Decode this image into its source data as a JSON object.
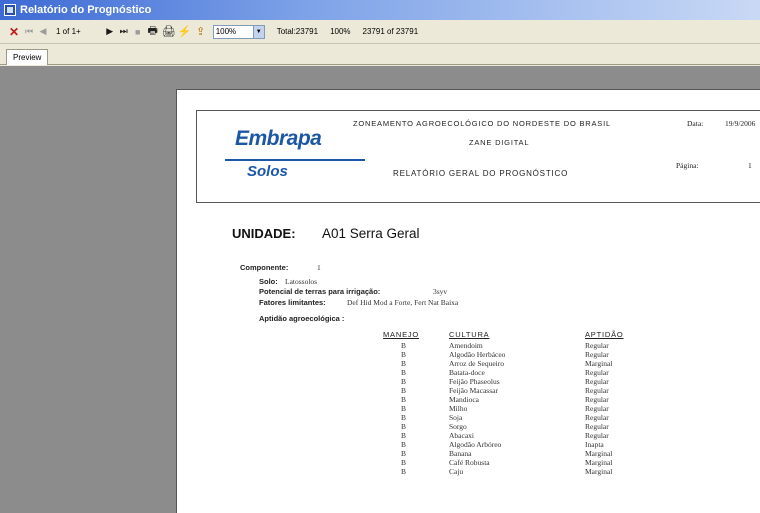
{
  "window": {
    "title": "Relatório do Prognóstico"
  },
  "toolbar": {
    "page_count": "1 of 1+",
    "zoom": "100%",
    "total": "Total:23791",
    "percent": "100%",
    "records": "23791 of 23791"
  },
  "tabs": [
    {
      "label": "Preview"
    }
  ],
  "report": {
    "logo_top": "Embrapa",
    "logo_bottom": "Solos",
    "header_line1": "ZONEAMENTO AGROECOLÓGICO DO NORDESTE DO BRASIL",
    "header_line2": "ZANE DIGITAL",
    "header_line3": "RELATÓRIO GERAL DO PROGNÓSTICO",
    "date_label": "Data:",
    "date_value": "19/9/2006",
    "page_label": "Página:",
    "page_value": "1",
    "unidade_label": "UNIDADE:",
    "unidade_value": "A01 Serra Geral",
    "componente_label": "Componente:",
    "componente_value": "1",
    "solo_label": "Solo:",
    "solo_value": "Latossolos",
    "potencial_label": "Potencial de terras para irrigação:",
    "potencial_value": "3syv",
    "fatores_label": "Fatores limitantes:",
    "fatores_value": "Def Hid Mod a Forte, Fert Nat Baixa",
    "aptidao_label": "Aptidão agroecológica :",
    "columns": {
      "manejo": "MANEJO",
      "cultura": "CULTURA",
      "aptidao": "APTIDÃO"
    },
    "rows": [
      {
        "manejo": "B",
        "cultura": "Amendoim",
        "aptidao": "Regular"
      },
      {
        "manejo": "B",
        "cultura": "Algodão Herbáceo",
        "aptidao": "Regular"
      },
      {
        "manejo": "B",
        "cultura": "Arroz de Sequeiro",
        "aptidao": "Marginal"
      },
      {
        "manejo": "B",
        "cultura": "Batata-doce",
        "aptidao": "Regular"
      },
      {
        "manejo": "B",
        "cultura": "Feijão Phaseolus",
        "aptidao": "Regular"
      },
      {
        "manejo": "B",
        "cultura": "Feijão Macassar",
        "aptidao": "Regular"
      },
      {
        "manejo": "B",
        "cultura": "Mandioca",
        "aptidao": "Regular"
      },
      {
        "manejo": "B",
        "cultura": "Milho",
        "aptidao": "Regular"
      },
      {
        "manejo": "B",
        "cultura": "Soja",
        "aptidao": "Regular"
      },
      {
        "manejo": "B",
        "cultura": "Sorgo",
        "aptidao": "Regular"
      },
      {
        "manejo": "B",
        "cultura": "Abacaxi",
        "aptidao": "Regular"
      },
      {
        "manejo": "B",
        "cultura": "Algodão Arbóreo",
        "aptidao": "Inapta"
      },
      {
        "manejo": "B",
        "cultura": "Banana",
        "aptidao": "Marginal"
      },
      {
        "manejo": "B",
        "cultura": "Café Robusta",
        "aptidao": "Marginal"
      },
      {
        "manejo": "B",
        "cultura": "Caju",
        "aptidao": "Marginal"
      }
    ]
  }
}
